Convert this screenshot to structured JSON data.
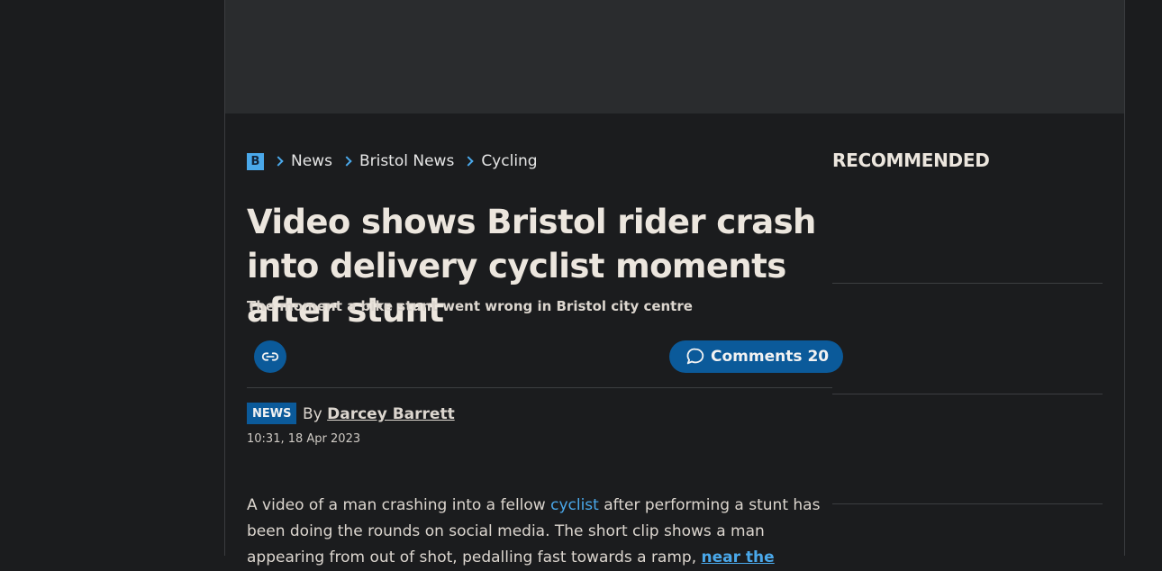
{
  "breadcrumb": {
    "logo_letter": "B",
    "items": [
      "News",
      "Bristol News",
      "Cycling"
    ]
  },
  "article": {
    "headline": "Video shows Bristol rider crash into delivery cyclist moments after stunt",
    "standfirst": "The moment a bike stunt went wrong in Bristol city centre",
    "comments_label": "Comments",
    "comments_count": "20",
    "badge": "NEWS",
    "by_prefix": "By",
    "author": "Darcey Barrett",
    "timestamp": "10:31, 18 Apr 2023",
    "body": {
      "p1_a": "A video of a man crashing into a fellow ",
      "p1_link": "cyclist",
      "p1_b": " after performing a stunt has been doing the rounds on social media. The short clip shows a man appearing from out of shot, pedalling fast towards a ramp, ",
      "p1_link2": "near the"
    }
  },
  "sidebar": {
    "title": "RECOMMENDED"
  },
  "colors": {
    "background": "#1b1c1e",
    "accent_blue": "#0b5a9a",
    "link_blue": "#4aa8ea",
    "text": "#ece6de"
  },
  "icons": {
    "share": "link-icon",
    "comments": "speech-bubble-icon",
    "crumb_separator": "chevron-right-icon"
  }
}
